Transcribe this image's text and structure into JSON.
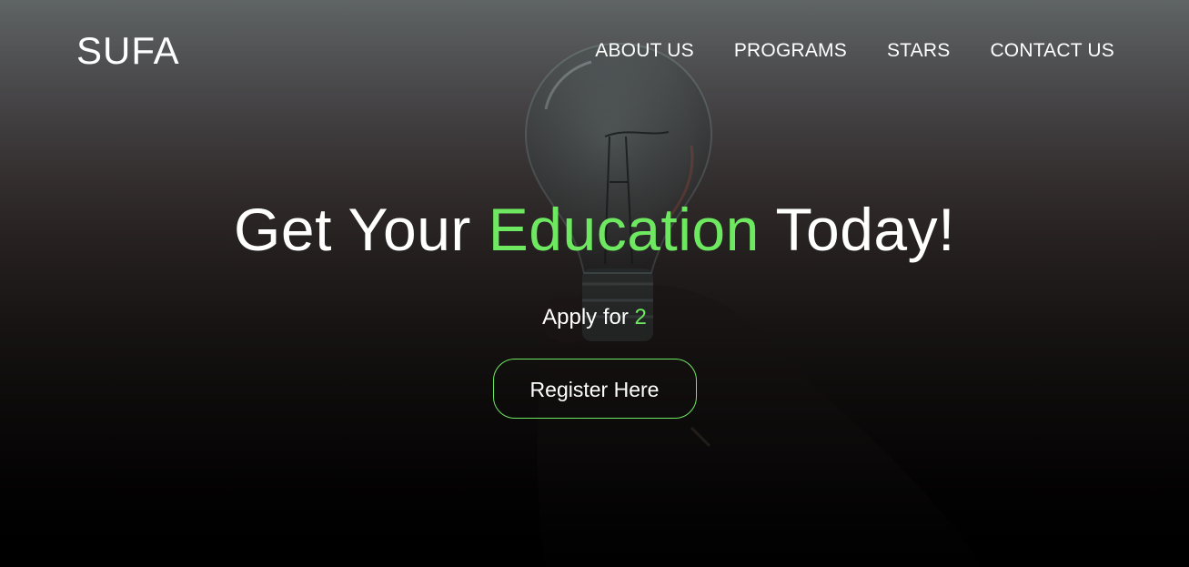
{
  "nav": {
    "brand": "SUFA",
    "links": [
      "ABOUT US",
      "PROGRAMS",
      "STARS",
      "CONTACT US"
    ]
  },
  "hero": {
    "headline_before": "Get Your",
    "headline_accent": "Education",
    "headline_after": "Today!",
    "subline_text": "Apply for",
    "subline_value": "2",
    "cta_label": "Register Here"
  },
  "colors": {
    "accent": "#6ee860",
    "text": "#ffffff"
  },
  "background_image": "light-bulb-held-in-hand"
}
